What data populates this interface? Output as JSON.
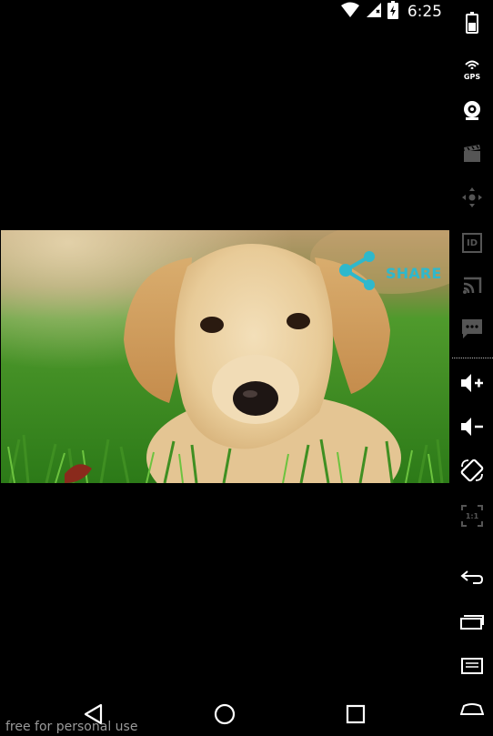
{
  "status_bar": {
    "time": "6:25",
    "icons": [
      "wifi-icon",
      "cell-signal-icon",
      "battery-charging-icon"
    ]
  },
  "content": {
    "share_label": "SHARE",
    "photo_subject": "puppy-photo"
  },
  "nav_bar": {
    "buttons": [
      "back-icon",
      "home-icon",
      "recents-icon"
    ]
  },
  "watermark": "free for personal use",
  "emulator_sidebar": {
    "gps_label": "GPS",
    "id_label": "ID",
    "scale_label": "1:1",
    "buttons": [
      "battery-icon",
      "gps-icon",
      "camera-icon",
      "video-icon",
      "dpad-icon",
      "id-icon",
      "cast-icon",
      "sms-icon",
      "volume-up-icon",
      "volume-down-icon",
      "rotate-icon",
      "scale-icon",
      "back-icon",
      "recents-icon",
      "menu-icon",
      "home-icon"
    ]
  },
  "colors": {
    "accent": "#2fb8cc",
    "background": "#000000",
    "sidebar_icon": "#ffffff",
    "sidebar_icon_disabled": "#555555"
  }
}
